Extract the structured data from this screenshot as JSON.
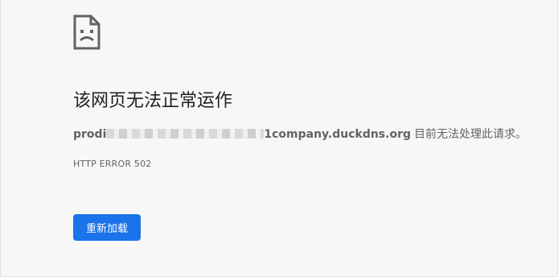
{
  "error_page": {
    "icon": "sad-page-icon",
    "title": "该网页无法正常运作",
    "host_prefix": "prodi",
    "host_suffix": "1company.duckdns.org",
    "summary_text": "目前无法处理此请求。",
    "error_code": "HTTP ERROR 502",
    "reload_label": "重新加载"
  },
  "colors": {
    "button": "#1a73e8",
    "title": "#202124",
    "text": "#5f6368",
    "background": "#f7f7f7"
  }
}
